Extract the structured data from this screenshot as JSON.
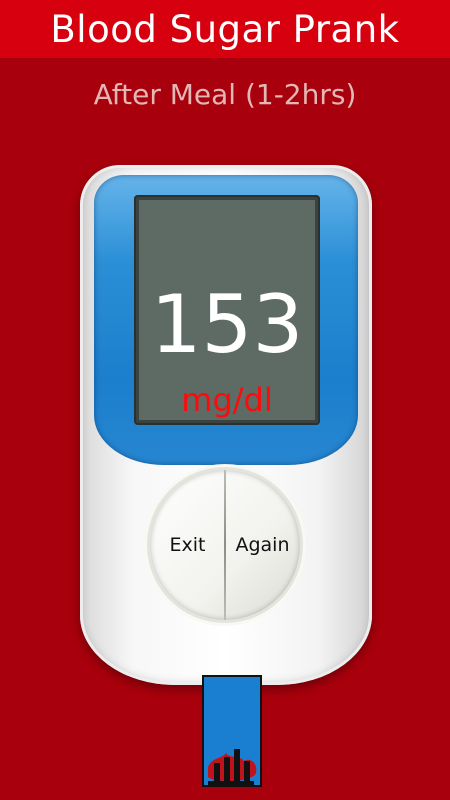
{
  "app": {
    "title": "Blood Sugar Prank",
    "subtitle": "After Meal (1-2hrs)"
  },
  "meter": {
    "reading": "153",
    "unit": "mg/dl"
  },
  "buttons": {
    "exit_label": "Exit",
    "again_label": "Again"
  },
  "colors": {
    "background": "#a8000c",
    "title_bar": "#d6000f",
    "meter_blue": "#1b7fcd",
    "lcd": "#5e6a64",
    "unit_red": "#ff0a0a"
  },
  "icons": {
    "strip_mark": "blood-drop-icon"
  }
}
